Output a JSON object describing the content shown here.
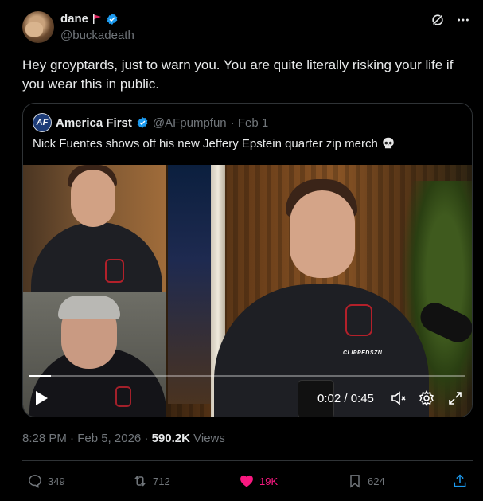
{
  "author": {
    "name": "dane",
    "handle": "@buckadeath"
  },
  "tweet_text": "Hey groyptards, just to warn you. You are quite literally risking your life if you wear this in public.",
  "quote": {
    "name": "America First",
    "handle": "@AFpumpfun",
    "date": "· Feb 1",
    "text": "Nick Fuentes shows off his new Jeffery Epstein quarter zip merch",
    "avatar_text": "AF",
    "video": {
      "watermark": "CLIPPEDSZN",
      "time": "0:02 / 0:45",
      "progress": 0.05
    }
  },
  "meta": {
    "timestamp": "8:28 PM · Feb 5, 2026 ·",
    "views_count": "590.2K",
    "views_label": "Views"
  },
  "actions": {
    "replies": "349",
    "reposts": "712",
    "likes": "19K",
    "bookmarks": "624"
  },
  "colors": {
    "background": "#000000",
    "text": "#e7e9ea",
    "muted": "#71767b",
    "border": "#2f3336",
    "verified": "#1d9bf0",
    "like": "#f91880",
    "flag": "#e0245e"
  },
  "icons": [
    "flag-icon",
    "verified-icon",
    "grok-icon",
    "more-icon",
    "skull-icon",
    "play-icon",
    "mute-icon",
    "gear-icon",
    "expand-icon",
    "reply-icon",
    "repost-icon",
    "like-icon",
    "bookmark-icon",
    "share-icon"
  ]
}
